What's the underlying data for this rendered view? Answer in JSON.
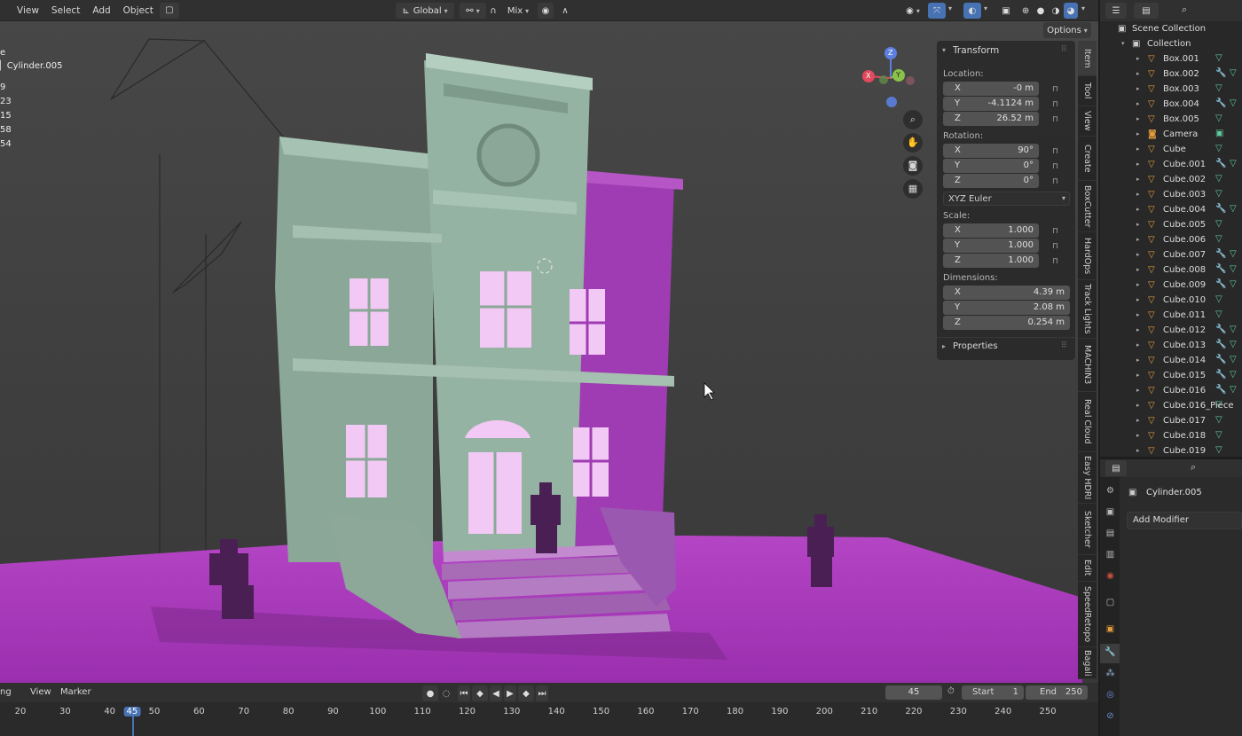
{
  "header": {
    "menus": [
      "View",
      "Select",
      "Add",
      "Object"
    ],
    "transform_orientation": "Global",
    "snap_mode": "Mix",
    "options_label": "Options"
  },
  "viewport": {
    "active_object_name": "Cylinder.005",
    "stats_fragment": "e",
    "stats_lines": [
      "9",
      "23",
      "15",
      "58",
      "54"
    ],
    "gizmo": {
      "z": "Z",
      "y": "Y",
      "x": "X"
    }
  },
  "npanel": {
    "title": "Transform",
    "location_label": "Location:",
    "location": [
      {
        "axis": "X",
        "value": "-0 m"
      },
      {
        "axis": "Y",
        "value": "-4.1124 m"
      },
      {
        "axis": "Z",
        "value": "26.52 m"
      }
    ],
    "rotation_label": "Rotation:",
    "rotation": [
      {
        "axis": "X",
        "value": "90°"
      },
      {
        "axis": "Y",
        "value": "0°"
      },
      {
        "axis": "Z",
        "value": "0°"
      }
    ],
    "rotation_mode": "XYZ Euler",
    "scale_label": "Scale:",
    "scale": [
      {
        "axis": "X",
        "value": "1.000"
      },
      {
        "axis": "Y",
        "value": "1.000"
      },
      {
        "axis": "Z",
        "value": "1.000"
      }
    ],
    "dimensions_label": "Dimensions:",
    "dimensions": [
      {
        "axis": "X",
        "value": "4.39 m"
      },
      {
        "axis": "Y",
        "value": "2.08 m"
      },
      {
        "axis": "Z",
        "value": "0.254 m"
      }
    ],
    "properties_label": "Properties"
  },
  "side_tabs": [
    "Item",
    "Tool",
    "View",
    "Create",
    "BoxCutter",
    "HardOps",
    "Track Lights",
    "MACHIN3",
    "Real Cloud",
    "Easy HDRI",
    "Sketcher",
    "Edit",
    "SpeedRetopo",
    "Bagali"
  ],
  "outliner": {
    "scene_collection": "Scene Collection",
    "collection": "Collection",
    "items": [
      "Box.001",
      "Box.002",
      "Box.003",
      "Box.004",
      "Box.005",
      "Camera",
      "Cube",
      "Cube.001",
      "Cube.002",
      "Cube.003",
      "Cube.004",
      "Cube.005",
      "Cube.006",
      "Cube.007",
      "Cube.008",
      "Cube.009",
      "Cube.010",
      "Cube.011",
      "Cube.012",
      "Cube.013",
      "Cube.014",
      "Cube.015",
      "Cube.016",
      "Cube.016_Piece",
      "Cube.017",
      "Cube.018",
      "Cube.019"
    ]
  },
  "properties": {
    "object_name": "Cylinder.005",
    "add_modifier": "Add Modifier"
  },
  "timeline": {
    "menu_fragment": "ng",
    "menus": [
      "View",
      "Marker"
    ],
    "current_frame": "45",
    "start_label": "Start",
    "start_value": "1",
    "end_label": "End",
    "end_value": "250",
    "ticks": [
      "20",
      "30",
      "40",
      "45",
      "50",
      "60",
      "70",
      "80",
      "90",
      "100",
      "110",
      "120",
      "130",
      "140",
      "150",
      "160",
      "170",
      "180",
      "190",
      "200",
      "210",
      "220",
      "230",
      "240",
      "250"
    ]
  },
  "colors": {
    "accent_blue": "#4772b3",
    "magenta_light": "#b03cc8",
    "mint_wall": "#8fb3a0",
    "window_glow": "#f2c8f4"
  }
}
